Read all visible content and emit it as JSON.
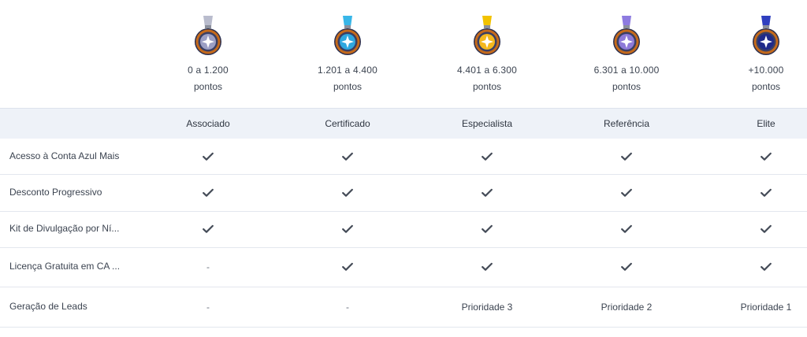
{
  "medals": [
    {
      "range": "0 a 1.200",
      "unit": "pontos",
      "icon": "silver-medal-icon",
      "ribbon": "#b9bccd",
      "face": "#9c9fc4",
      "ring": "#c56a1b"
    },
    {
      "range": "1.201 a 4.400",
      "unit": "pontos",
      "icon": "blue-medal-icon",
      "ribbon": "#38b6e8",
      "face": "#2fa7df",
      "ring": "#c56a1b"
    },
    {
      "range": "4.401 a 6.300",
      "unit": "pontos",
      "icon": "gold-medal-icon",
      "ribbon": "#f2c200",
      "face": "#f4b81e",
      "ring": "#c56a1b"
    },
    {
      "range": "6.301 a 10.000",
      "unit": "pontos",
      "icon": "purple-medal-icon",
      "ribbon": "#8d7be0",
      "face": "#8e7ad8",
      "ring": "#c56a1b"
    },
    {
      "range": "+10.000",
      "unit": "pontos",
      "icon": "navy-medal-icon",
      "ribbon": "#2f3fbf",
      "face": "#1f2a8a",
      "ring": "#c56a1b"
    }
  ],
  "tiers": [
    "Associado",
    "Certificado",
    "Especialista",
    "Referência",
    "Elite"
  ],
  "features": [
    {
      "label": "Acesso à Conta Azul Mais",
      "values": [
        "check",
        "check",
        "check",
        "check",
        "check"
      ]
    },
    {
      "label": "Desconto Progressivo",
      "values": [
        "check",
        "check",
        "check",
        "check",
        "check"
      ]
    },
    {
      "label": "Kit de Divulgação por Ní...",
      "values": [
        "check",
        "check",
        "check",
        "check",
        "check"
      ]
    },
    {
      "label": "Licença Gratuita em CA ...",
      "values": [
        "-",
        "check",
        "check",
        "check",
        "check"
      ]
    },
    {
      "label": "Geração de Leads",
      "values": [
        "-",
        "-",
        "Prioridade 3",
        "Prioridade 2",
        "Prioridade 1"
      ]
    }
  ]
}
